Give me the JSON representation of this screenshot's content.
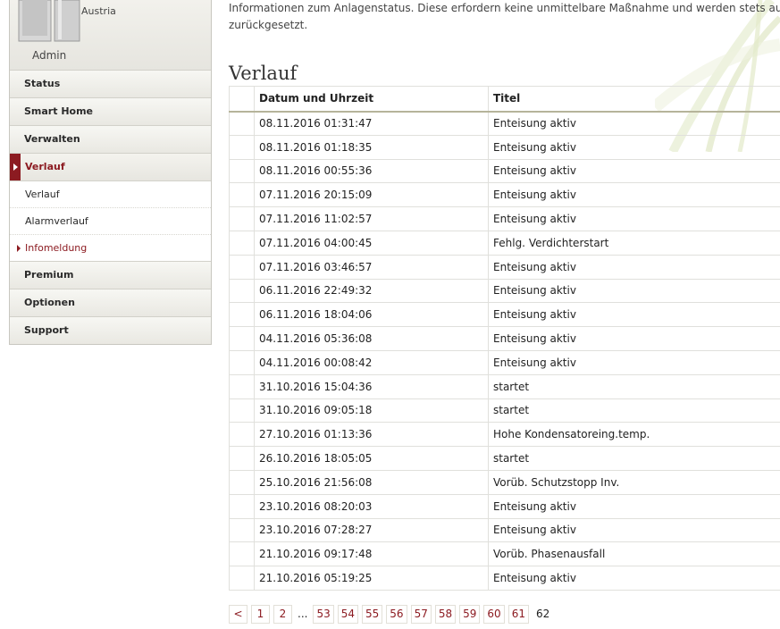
{
  "sidebar": {
    "country": "Austria",
    "user": "Admin",
    "menu": {
      "status": "Status",
      "smart_home": "Smart Home",
      "verwalten": "Verwalten",
      "verlauf": "Verlauf",
      "sub_verlauf": "Verlauf",
      "sub_alarmverlauf": "Alarmverlauf",
      "sub_infomeldung": "Infomeldung",
      "premium": "Premium",
      "optionen": "Optionen",
      "support": "Support"
    }
  },
  "main": {
    "info_line1": "Informationen zum Anlagenstatus. Diese erfordern keine unmittelbare Maßnahme und werden stets autor",
    "info_line2": "zurückgesetzt.",
    "section_title": "Verlauf",
    "table": {
      "headers": [
        "",
        "Datum und Uhrzeit",
        "Titel"
      ],
      "rows": [
        [
          "08.11.2016 01:31:47",
          "Enteisung aktiv"
        ],
        [
          "08.11.2016 01:18:35",
          "Enteisung aktiv"
        ],
        [
          "08.11.2016 00:55:36",
          "Enteisung aktiv"
        ],
        [
          "07.11.2016 20:15:09",
          "Enteisung aktiv"
        ],
        [
          "07.11.2016 11:02:57",
          "Enteisung aktiv"
        ],
        [
          "07.11.2016 04:00:45",
          "Fehlg. Verdichterstart"
        ],
        [
          "07.11.2016 03:46:57",
          "Enteisung aktiv"
        ],
        [
          "06.11.2016 22:49:32",
          "Enteisung aktiv"
        ],
        [
          "06.11.2016 18:04:06",
          "Enteisung aktiv"
        ],
        [
          "04.11.2016 05:36:08",
          "Enteisung aktiv"
        ],
        [
          "04.11.2016 00:08:42",
          "Enteisung aktiv"
        ],
        [
          "31.10.2016 15:04:36",
          "startet"
        ],
        [
          "31.10.2016 09:05:18",
          "startet"
        ],
        [
          "27.10.2016 01:13:36",
          "Hohe Kondensatoreing.temp."
        ],
        [
          "26.10.2016 18:05:05",
          "startet"
        ],
        [
          "25.10.2016 21:56:08",
          "Vorüb. Schutzstopp Inv."
        ],
        [
          "23.10.2016 08:20:03",
          "Enteisung aktiv"
        ],
        [
          "23.10.2016 07:28:27",
          "Enteisung aktiv"
        ],
        [
          "21.10.2016 09:17:48",
          "Vorüb. Phasenausfall"
        ],
        [
          "21.10.2016 05:19:25",
          "Enteisung aktiv"
        ]
      ]
    },
    "pagination": {
      "prev": "<",
      "pages": [
        "1",
        "2",
        "...",
        "53",
        "54",
        "55",
        "56",
        "57",
        "58",
        "59",
        "60",
        "61",
        "62"
      ],
      "current": "62"
    }
  }
}
